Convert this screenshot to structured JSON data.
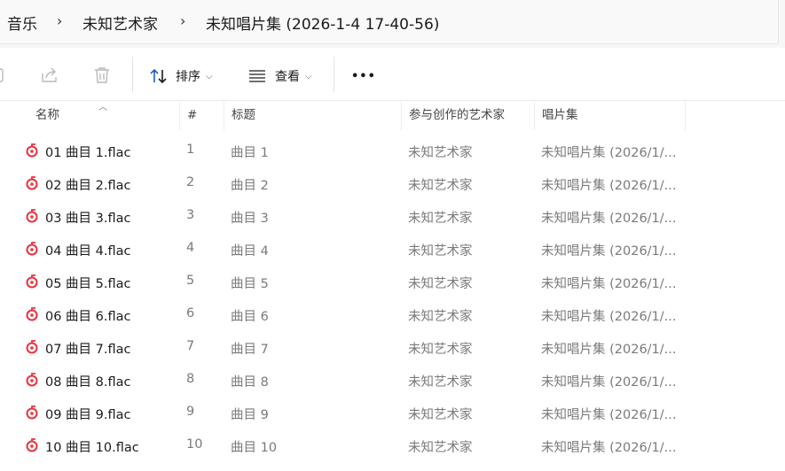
{
  "breadcrumb": {
    "items": [
      "音乐",
      "未知艺术家",
      "未知唱片集 (2026-1-4 17-40-56)"
    ],
    "separator": "›"
  },
  "toolbar": {
    "sort_label": "排序",
    "view_label": "查看",
    "more_label": "•••",
    "icons": [
      "copy-icon",
      "share-icon",
      "delete-icon",
      "sort-icon",
      "view-icon"
    ]
  },
  "columns": {
    "name": "名称",
    "number": "#",
    "title": "标题",
    "artist": "参与创作的艺术家",
    "album": "唱片集"
  },
  "files": [
    {
      "name": "01 曲目 1.flac",
      "num": "1",
      "title": "曲目 1",
      "artist": "未知艺术家",
      "album": "未知唱片集 (2026/1/..."
    },
    {
      "name": "02 曲目 2.flac",
      "num": "2",
      "title": "曲目 2",
      "artist": "未知艺术家",
      "album": "未知唱片集 (2026/1/..."
    },
    {
      "name": "03 曲目 3.flac",
      "num": "3",
      "title": "曲目 3",
      "artist": "未知艺术家",
      "album": "未知唱片集 (2026/1/..."
    },
    {
      "name": "04 曲目 4.flac",
      "num": "4",
      "title": "曲目 4",
      "artist": "未知艺术家",
      "album": "未知唱片集 (2026/1/..."
    },
    {
      "name": "05 曲目 5.flac",
      "num": "5",
      "title": "曲目 5",
      "artist": "未知艺术家",
      "album": "未知唱片集 (2026/1/..."
    },
    {
      "name": "06 曲目 6.flac",
      "num": "6",
      "title": "曲目 6",
      "artist": "未知艺术家",
      "album": "未知唱片集 (2026/1/..."
    },
    {
      "name": "07 曲目 7.flac",
      "num": "7",
      "title": "曲目 7",
      "artist": "未知艺术家",
      "album": "未知唱片集 (2026/1/..."
    },
    {
      "name": "08 曲目 8.flac",
      "num": "8",
      "title": "曲目 8",
      "artist": "未知艺术家",
      "album": "未知唱片集 (2026/1/..."
    },
    {
      "name": "09 曲目 9.flac",
      "num": "9",
      "title": "曲目 9",
      "artist": "未知艺术家",
      "album": "未知唱片集 (2026/1/..."
    },
    {
      "name": "10 曲目 10.flac",
      "num": "10",
      "title": "曲目 10",
      "artist": "未知艺术家",
      "album": "未知唱片集 (2026/1/..."
    }
  ],
  "colors": {
    "file_icon": "#e8333f",
    "toolbar_icon_disabled": "#b9b9b9",
    "sort_icon": "#1f5fbf"
  }
}
